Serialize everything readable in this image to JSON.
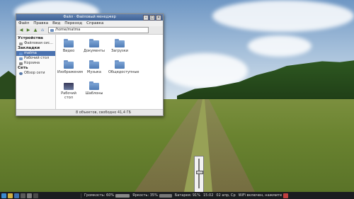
{
  "window": {
    "title": "Файл · Файловый менеджер",
    "menu": [
      "Файл",
      "Правка",
      "Вид",
      "Переход",
      "Справка"
    ],
    "location": "/home/matma"
  },
  "sidebar": {
    "devices_header": "Устройства",
    "devices": [
      "Файловая сис..."
    ],
    "bookmarks_header": "Закладки",
    "bookmarks": [
      "matma",
      "Рабочий стол",
      "Корзина"
    ],
    "network_header": "Сеть",
    "network": [
      "Обзор сети"
    ]
  },
  "files": [
    "Видео",
    "Документы",
    "Загрузки",
    "Изображения",
    "Музыка",
    "Общедоступные",
    "Рабочий стол",
    "Шаблоны"
  ],
  "status": "8 объектов, свободно 41,4 ГБ",
  "taskbar": {
    "brightness": "Громкость: 60%",
    "volume": "Яркость: 35%",
    "battery": "Батарея: 91%",
    "clock": "15:02",
    "date": "02 апр, Ср",
    "wifi": "WiFi включен, нажмите"
  },
  "colors": {
    "titlebar": "#4a6fa5",
    "selection": "#4a72b0",
    "taskbar": "#1b1d20"
  },
  "volume_level": 0.55
}
